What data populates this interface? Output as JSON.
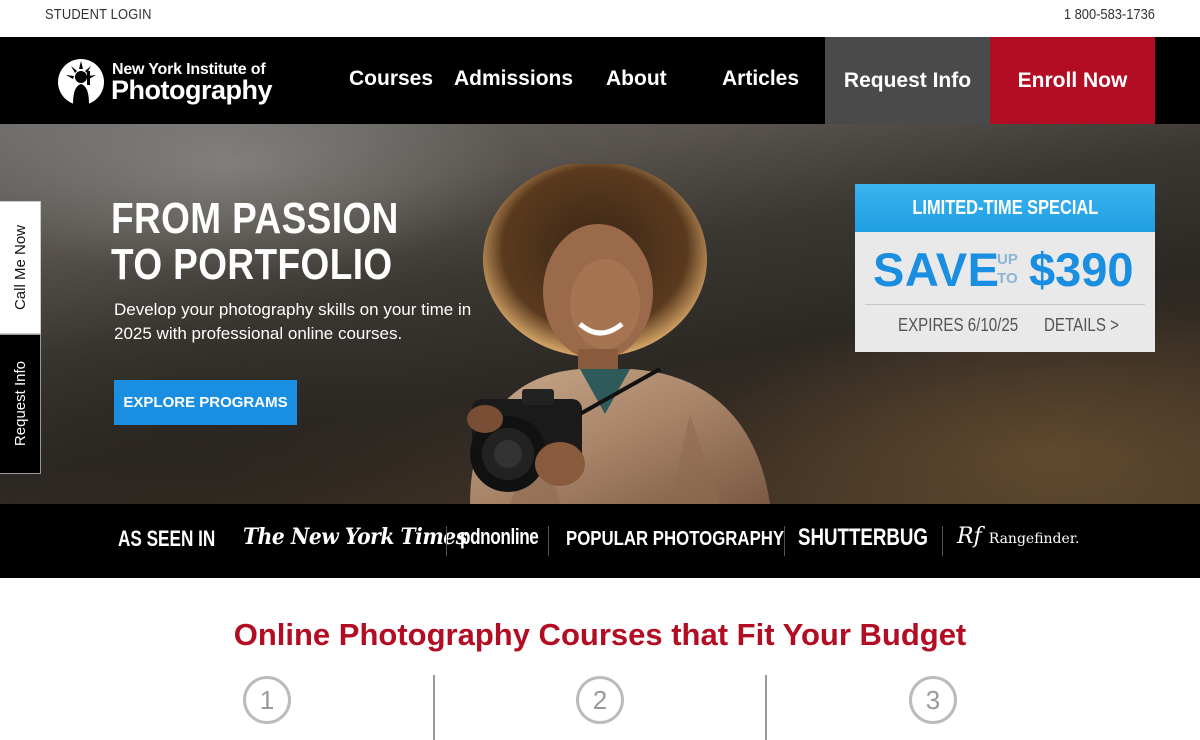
{
  "utility": {
    "login": "STUDENT LOGIN",
    "phone": "1 800-583-1736"
  },
  "brand": {
    "line1": "New York Institute of",
    "line2": "Photography"
  },
  "nav": {
    "items": [
      "Courses",
      "Admissions",
      "About",
      "Articles"
    ],
    "request": "Request Info",
    "enroll": "Enroll Now"
  },
  "hero": {
    "headline_1": "FROM PASSION",
    "headline_2": "TO PORTFOLIO",
    "subtext": "Develop your photography skills on your time in 2025 with professional online courses.",
    "cta": "EXPLORE PROGRAMS"
  },
  "promo": {
    "label": "LIMITED-TIME SPECIAL",
    "save": "SAVE",
    "up": "UP",
    "to": "TO",
    "amount": "$390",
    "expires": "EXPIRES 6/10/25",
    "details": "DETAILS >"
  },
  "side_tabs": {
    "call": "Call Me Now",
    "request": "Request Info"
  },
  "press": {
    "label": "AS SEEN IN",
    "outlets": [
      "The New York Times",
      "pdnonline",
      "POPULAR PHOTOGRAPHY",
      "SHUTTERBUG",
      "Rf",
      "Rangefinder."
    ]
  },
  "courses": {
    "title": "Online Photography Courses that Fit Your Budget",
    "steps": [
      "1",
      "2",
      "3"
    ]
  },
  "colors": {
    "brand_red": "#b30d23",
    "accent_blue": "#1a8ee0",
    "nav_bg": "#000000",
    "request_bg": "#4a4a4a"
  }
}
